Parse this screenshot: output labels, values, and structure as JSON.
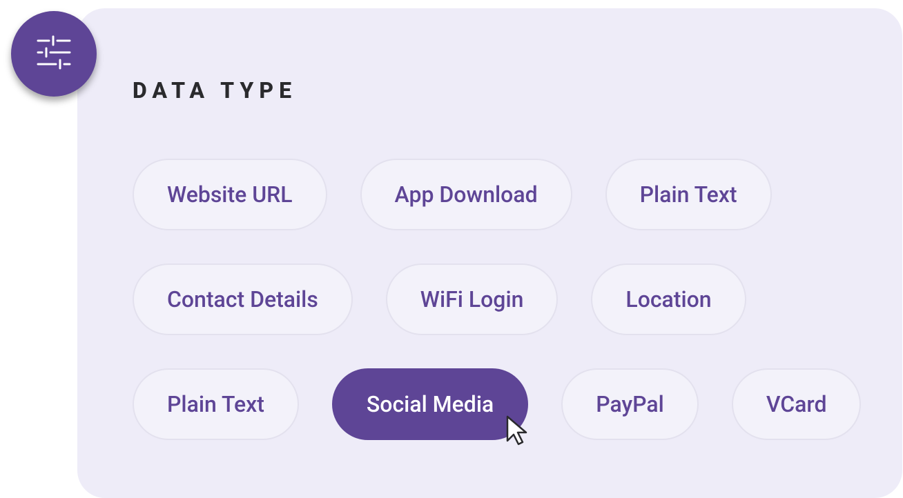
{
  "heading": "DATA TYPE",
  "options": {
    "row1": [
      {
        "label": "Website URL",
        "selected": false
      },
      {
        "label": "App Download",
        "selected": false
      },
      {
        "label": "Plain Text",
        "selected": false
      }
    ],
    "row2": [
      {
        "label": "Contact Details",
        "selected": false
      },
      {
        "label": "WiFi Login",
        "selected": false
      },
      {
        "label": "Location",
        "selected": false
      }
    ],
    "row3": [
      {
        "label": "Plain Text",
        "selected": false
      },
      {
        "label": "Social Media",
        "selected": true
      },
      {
        "label": "PayPal",
        "selected": false
      },
      {
        "label": "VCard",
        "selected": false
      }
    ]
  },
  "colors": {
    "panel_bg": "#EEECF8",
    "accent": "#5E4596",
    "pill_bg": "#F3F2FA",
    "pill_border": "#E3E1EE",
    "heading": "#2A2A2D"
  }
}
